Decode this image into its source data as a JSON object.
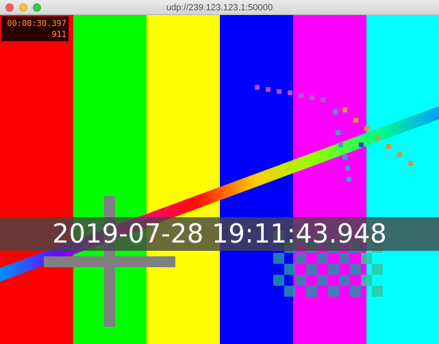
{
  "window": {
    "title": "udp://239.123.123.1:50000",
    "buttons": [
      "close",
      "minimize",
      "zoom"
    ]
  },
  "osd": {
    "elapsed": "00:00:30.397",
    "frame": "911"
  },
  "overlay": {
    "timestamp": "2019-07-28 19:11:43.948"
  },
  "colors": {
    "bars": [
      "#ff0000",
      "#00ff00",
      "#ffff00",
      "#0000ff",
      "#ff00ff",
      "#00ffff"
    ],
    "osd_text": "#ff9a1a",
    "crosshair": "#808080"
  }
}
